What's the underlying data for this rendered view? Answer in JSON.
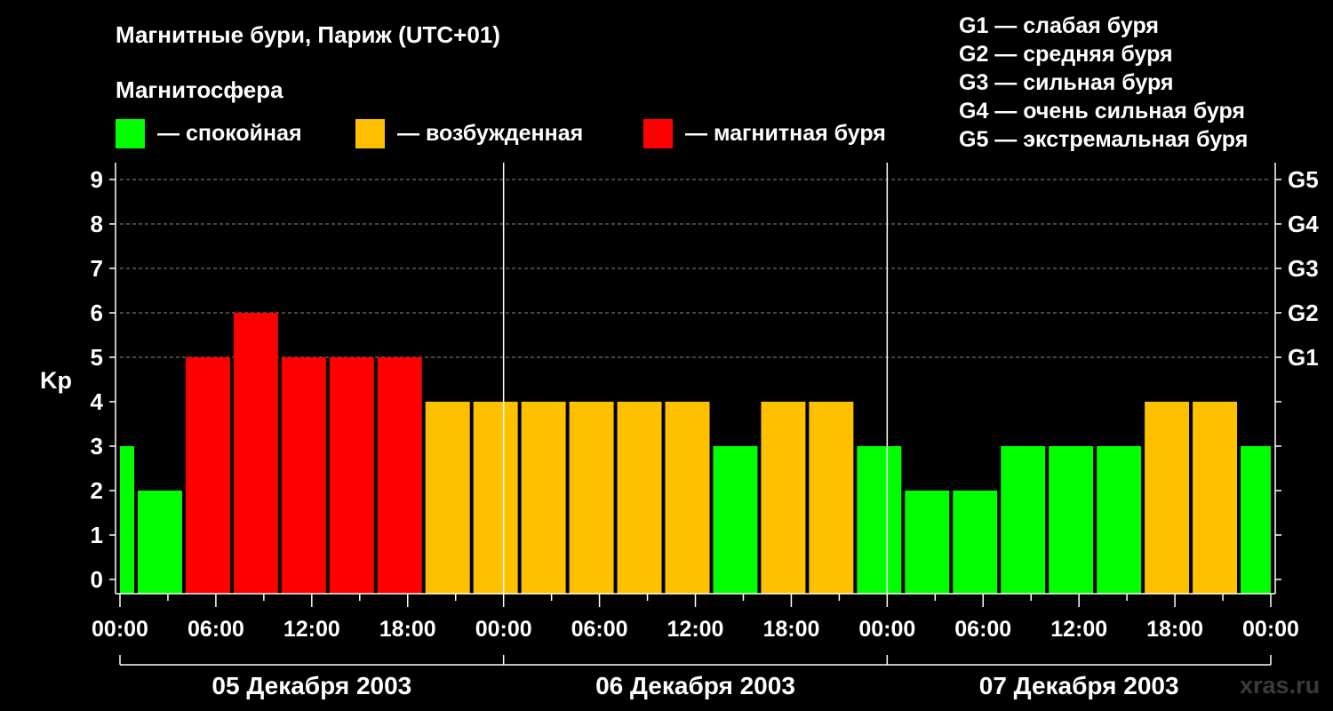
{
  "chart_data": {
    "type": "bar",
    "title": "Магнитные бури, Париж (UTC+01)",
    "legend_title": "Магнитосфера",
    "legend": [
      {
        "label": "— спокойная",
        "color": "#00ff00"
      },
      {
        "label": "— возбужденная",
        "color": "#ffc000"
      },
      {
        "label": "— магнитная буря",
        "color": "#ff0000"
      }
    ],
    "g_scale": [
      "G1 — слабая буря",
      "G2 — средняя буря",
      "G3 — сильная буря",
      "G4 — очень сильная буря",
      "G5 — экстремальная буря"
    ],
    "ylabel": "Kp",
    "ylim": [
      0,
      9
    ],
    "y_ticks": [
      "0",
      "1",
      "2",
      "3",
      "4",
      "5",
      "6",
      "7",
      "8",
      "9"
    ],
    "right_ticks": [
      {
        "kp": 5,
        "label": "G1"
      },
      {
        "kp": 6,
        "label": "G2"
      },
      {
        "kp": 7,
        "label": "G3"
      },
      {
        "kp": 8,
        "label": "G4"
      },
      {
        "kp": 9,
        "label": "G5"
      }
    ],
    "x_tick_labels": [
      "00:00",
      "06:00",
      "12:00",
      "18:00",
      "00:00",
      "06:00",
      "12:00",
      "18:00",
      "00:00",
      "06:00",
      "12:00",
      "18:00",
      "00:00"
    ],
    "days": [
      "05 Декабря 2003",
      "06 Декабря 2003",
      "07 Декабря 2003"
    ],
    "start_hour": 0,
    "end_hour": 72,
    "bar_hours": 3,
    "bars": [
      {
        "start": -2,
        "kp": 3,
        "status": "quiet"
      },
      {
        "start": 1,
        "kp": 2,
        "status": "quiet"
      },
      {
        "start": 4,
        "kp": 5,
        "status": "storm"
      },
      {
        "start": 7,
        "kp": 6,
        "status": "storm"
      },
      {
        "start": 10,
        "kp": 5,
        "status": "storm"
      },
      {
        "start": 13,
        "kp": 5,
        "status": "storm"
      },
      {
        "start": 16,
        "kp": 5,
        "status": "storm"
      },
      {
        "start": 19,
        "kp": 4,
        "status": "unsettled"
      },
      {
        "start": 22,
        "kp": 4,
        "status": "unsettled"
      },
      {
        "start": 25,
        "kp": 4,
        "status": "unsettled"
      },
      {
        "start": 28,
        "kp": 4,
        "status": "unsettled"
      },
      {
        "start": 31,
        "kp": 4,
        "status": "unsettled"
      },
      {
        "start": 34,
        "kp": 4,
        "status": "unsettled"
      },
      {
        "start": 37,
        "kp": 3,
        "status": "quiet"
      },
      {
        "start": 40,
        "kp": 4,
        "status": "unsettled"
      },
      {
        "start": 43,
        "kp": 4,
        "status": "unsettled"
      },
      {
        "start": 46,
        "kp": 3,
        "status": "quiet"
      },
      {
        "start": 49,
        "kp": 2,
        "status": "quiet"
      },
      {
        "start": 52,
        "kp": 2,
        "status": "quiet"
      },
      {
        "start": 55,
        "kp": 3,
        "status": "quiet"
      },
      {
        "start": 58,
        "kp": 3,
        "status": "quiet"
      },
      {
        "start": 61,
        "kp": 3,
        "status": "quiet"
      },
      {
        "start": 64,
        "kp": 4,
        "status": "unsettled"
      },
      {
        "start": 67,
        "kp": 4,
        "status": "unsettled"
      },
      {
        "start": 70,
        "kp": 3,
        "status": "quiet"
      }
    ],
    "status_colors": {
      "quiet": "#00ff00",
      "unsettled": "#ffc000",
      "storm": "#ff0000"
    },
    "grid": true,
    "watermark": "xras.ru"
  }
}
